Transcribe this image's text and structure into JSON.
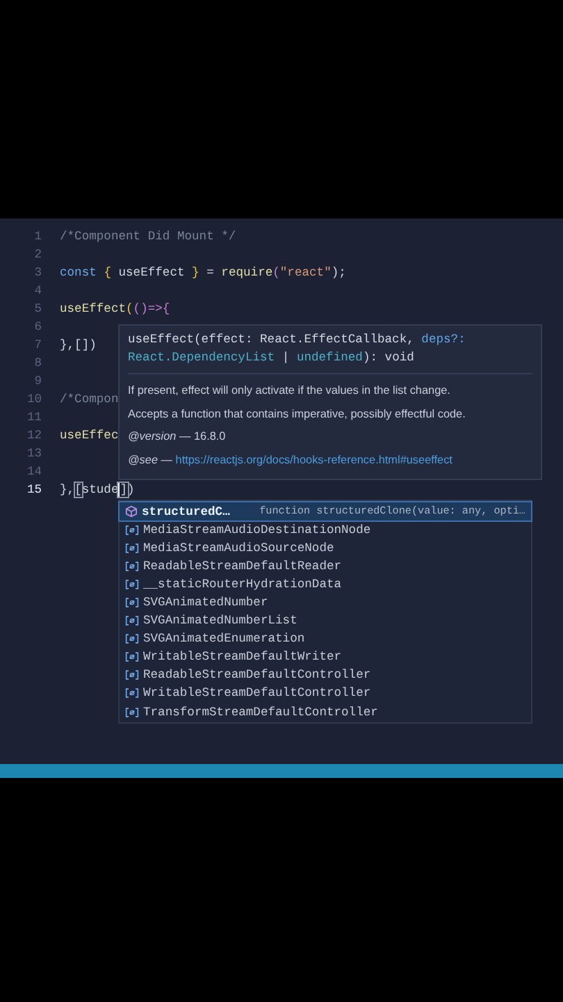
{
  "editor": {
    "lines": [
      {
        "number": "1",
        "current": false,
        "tokens": [
          {
            "text": "/*Component Did Mount */",
            "kind": "comment"
          }
        ]
      },
      {
        "number": "2",
        "current": false
      },
      {
        "number": "3",
        "current": false,
        "tokens": [
          {
            "text": "const ",
            "kind": "keyword"
          },
          {
            "text": "{",
            "kind": "brace"
          },
          {
            "text": " useEffect ",
            "kind": "plain"
          },
          {
            "text": "}",
            "kind": "brace"
          },
          {
            "text": " = ",
            "kind": "plain"
          },
          {
            "text": "require",
            "kind": "func"
          },
          {
            "text": "(",
            "kind": "paren"
          },
          {
            "text": "\"react\"",
            "kind": "string"
          },
          {
            "text": ");",
            "kind": "plain"
          }
        ]
      },
      {
        "number": "4",
        "current": false
      },
      {
        "number": "5",
        "current": false,
        "tokens": [
          {
            "text": "useEffect",
            "kind": "func"
          },
          {
            "text": "(",
            "kind": "brace"
          },
          {
            "text": "()=>{",
            "kind": "paren"
          }
        ]
      },
      {
        "number": "6",
        "current": false
      },
      {
        "number": "7",
        "current": false,
        "tokens": [
          {
            "text": "},[])",
            "kind": "plain"
          }
        ]
      },
      {
        "number": "8",
        "current": false
      },
      {
        "number": "9",
        "current": false
      },
      {
        "number": "10",
        "current": false,
        "tokens": [
          {
            "text": "/*Compon",
            "kind": "comment"
          }
        ]
      },
      {
        "number": "11",
        "current": false
      },
      {
        "number": "12",
        "current": false,
        "tokens": [
          {
            "text": "useEffec",
            "kind": "func"
          }
        ]
      },
      {
        "number": "13",
        "current": false
      },
      {
        "number": "14",
        "current": false
      },
      {
        "number": "15",
        "current": true,
        "tokens": [
          {
            "text": "},",
            "kind": "plain"
          },
          {
            "text": "[",
            "kind": "match"
          },
          {
            "text": "stude",
            "kind": "plain"
          },
          {
            "text": "]",
            "kind": "caret-match"
          },
          {
            "text": ")",
            "kind": "plain"
          }
        ]
      }
    ]
  },
  "hover": {
    "signature": [
      [
        {
          "text": "useEffect(effect: React.EffectCallback, ",
          "kind": "plain"
        },
        {
          "text": "deps?:",
          "kind": "param"
        }
      ],
      [
        {
          "text": "React.DependencyList",
          "kind": "type"
        },
        {
          "text": " | ",
          "kind": "plain"
        },
        {
          "text": "undefined",
          "kind": "type"
        },
        {
          "text": "): void",
          "kind": "plain"
        }
      ]
    ],
    "docs": [
      "If present, effect will only activate if the values in the list change.",
      "Accepts a function that contains imperative, possibly effectful code."
    ],
    "version": "*@version* — 16.8.0",
    "see_label": "*@see* — ",
    "see_link": "https://reactjs.org/docs/hooks-reference.html#useeffect"
  },
  "suggestions": [
    {
      "label": "structuredC…",
      "kind": "method",
      "selected": true,
      "detail": "function structuredClone(value: any, opti…"
    },
    {
      "label": "MediaStreamAudioDestinationNode",
      "kind": "variable",
      "selected": false
    },
    {
      "label": "MediaStreamAudioSourceNode",
      "kind": "variable",
      "selected": false
    },
    {
      "label": "ReadableStreamDefaultReader",
      "kind": "variable",
      "selected": false
    },
    {
      "label": "__staticRouterHydrationData",
      "kind": "variable",
      "selected": false
    },
    {
      "label": "SVGAnimatedNumber",
      "kind": "variable",
      "selected": false
    },
    {
      "label": "SVGAnimatedNumberList",
      "kind": "variable",
      "selected": false
    },
    {
      "label": "SVGAnimatedEnumeration",
      "kind": "variable",
      "selected": false
    },
    {
      "label": "WritableStreamDefaultWriter",
      "kind": "variable",
      "selected": false
    },
    {
      "label": "ReadableStreamDefaultController",
      "kind": "variable",
      "selected": false
    },
    {
      "label": "WritableStreamDefaultController",
      "kind": "variable",
      "selected": false
    },
    {
      "label": "TransformStreamDefaultController",
      "kind": "variable",
      "selected": false
    }
  ]
}
